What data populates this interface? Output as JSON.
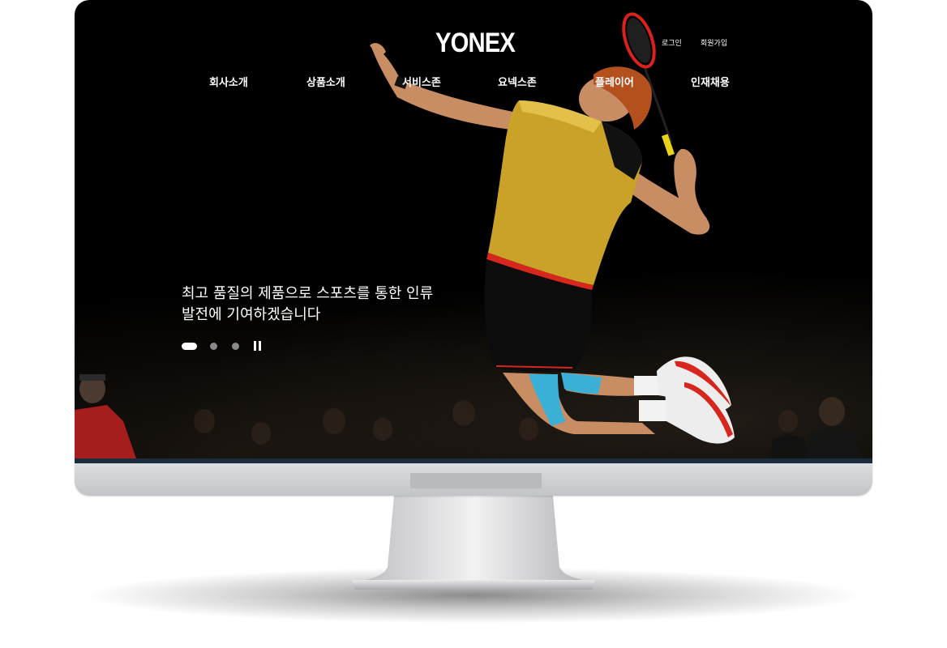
{
  "site": {
    "logo": "YONEX",
    "util_links": {
      "login": "로그인",
      "join": "회원가입"
    },
    "nav": [
      {
        "label": "회사소개"
      },
      {
        "label": "상품소개"
      },
      {
        "label": "서비스존"
      },
      {
        "label": "요넥스존"
      },
      {
        "label": "플레이어"
      },
      {
        "label": "인재채용"
      }
    ]
  },
  "hero": {
    "line1": "최고 품질의 제품으로 스포츠를 통한 인류",
    "line2": "발전에 기여하겠습니다",
    "slides_total": 3,
    "active_slide": 1
  },
  "colors": {
    "background": "#000000",
    "text": "#ffffff",
    "jersey": "#c9a227",
    "accent_red": "#d7261e",
    "frame_silver": "#d0d1d4"
  }
}
